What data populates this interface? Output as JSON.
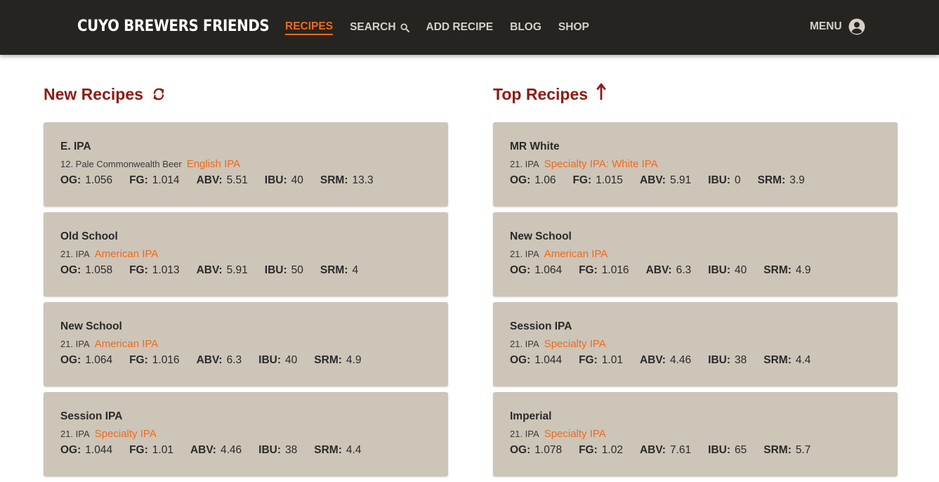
{
  "header": {
    "brand": "CUYO BREWERS FRIENDS",
    "nav": [
      {
        "label": "RECIPES",
        "active": true
      },
      {
        "label": "SEARCH",
        "icon": "search-icon"
      },
      {
        "label": "ADD RECIPE"
      },
      {
        "label": "BLOG"
      },
      {
        "label": "SHOP"
      }
    ],
    "menu_label": "MENU",
    "menu_icon": "user-avatar-icon",
    "accent_color": "#f0691c",
    "bar_color": "#262421"
  },
  "new_recipes": {
    "title": "New Recipes",
    "icon": "refresh-icon",
    "cards": [
      {
        "name": "E. IPA",
        "category": "12. Pale Commonwealth Beer",
        "style": "English IPA",
        "og": "1.056",
        "fg": "1.014",
        "abv": "5.51",
        "ibu": "40",
        "srm": "13.3"
      },
      {
        "name": "Old School",
        "category": "21. IPA",
        "style": "American IPA",
        "og": "1.058",
        "fg": "1.013",
        "abv": "5.91",
        "ibu": "50",
        "srm": "4"
      },
      {
        "name": "New School",
        "category": "21. IPA",
        "style": "American IPA",
        "og": "1.064",
        "fg": "1.016",
        "abv": "6.3",
        "ibu": "40",
        "srm": "4.9"
      },
      {
        "name": "Session IPA",
        "category": "21. IPA",
        "style": "Specialty IPA",
        "og": "1.044",
        "fg": "1.01",
        "abv": "4.46",
        "ibu": "38",
        "srm": "4.4"
      }
    ]
  },
  "top_recipes": {
    "title": "Top Recipes",
    "icon": "arrow-up-icon",
    "cards": [
      {
        "name": "MR White",
        "category": "21. IPA",
        "style": "Specialty IPA: White IPA",
        "og": "1.06",
        "fg": "1.015",
        "abv": "5.91",
        "ibu": "0",
        "srm": "3.9"
      },
      {
        "name": "New School",
        "category": "21. IPA",
        "style": "American IPA",
        "og": "1.064",
        "fg": "1.016",
        "abv": "6.3",
        "ibu": "40",
        "srm": "4.9"
      },
      {
        "name": "Session IPA",
        "category": "21. IPA",
        "style": "Specialty IPA",
        "og": "1.044",
        "fg": "1.01",
        "abv": "4.46",
        "ibu": "38",
        "srm": "4.4"
      },
      {
        "name": "Imperial",
        "category": "21. IPA",
        "style": "Specialty IPA",
        "og": "1.078",
        "fg": "1.02",
        "abv": "7.61",
        "ibu": "65",
        "srm": "5.7"
      }
    ]
  },
  "stat_labels": {
    "og": "OG:",
    "fg": "FG:",
    "abv": "ABV:",
    "ibu": "IBU:",
    "srm": "SRM:"
  }
}
